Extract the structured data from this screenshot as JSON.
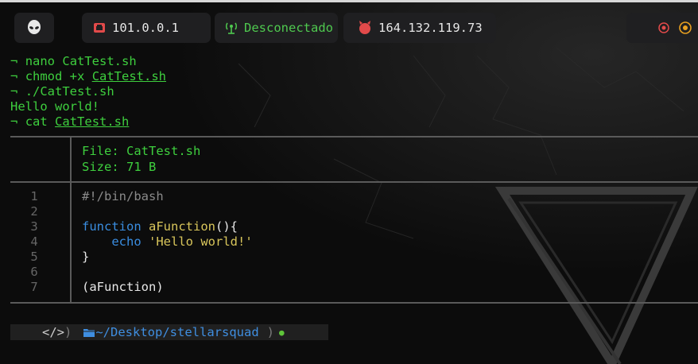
{
  "topbar": {
    "alien_icon": "alien-icon",
    "local_ip": "101.0.0.1",
    "vpn_status": "Desconectado",
    "target_ip": "164.132.119.73"
  },
  "terminal": {
    "lines": [
      {
        "prompt": "¬",
        "cmd": "nano",
        "arg": "CatTest.sh",
        "underline": false
      },
      {
        "prompt": "¬",
        "cmd": "chmod +x",
        "arg": "CatTest.sh",
        "underline": true
      },
      {
        "prompt": "¬",
        "cmd": "./CatTest.sh",
        "arg": "",
        "underline": false
      }
    ],
    "output": "Hello world!",
    "cat_line": {
      "prompt": "¬",
      "cmd": "cat",
      "arg": "CatTest.sh"
    }
  },
  "bat": {
    "file_label": "File: CatTest.sh",
    "size_label": "Size: 71 B",
    "line_numbers": [
      "1",
      "2",
      "3",
      "4",
      "5",
      "6",
      "7"
    ],
    "code": {
      "l1": "#!/bin/bash",
      "l3_kw": "function",
      "l3_fn": "aFunction",
      "l3_rest": "(){",
      "l4_echo": "echo",
      "l4_str": "'Hello world!'",
      "l5": "}",
      "l7": "(aFunction)"
    }
  },
  "statusline": {
    "code_icon": "</>",
    "close_paren": ")",
    "folder_icon": "folder-icon",
    "path_prefix": "~/Desktop/",
    "path_dir": "stellarsquad",
    "end_paren": ")",
    "dot": "●"
  },
  "colors": {
    "green": "#3ecf3e",
    "blue": "#3a8de0",
    "yellow": "#d9c65b",
    "panel": "#1f1f21"
  }
}
